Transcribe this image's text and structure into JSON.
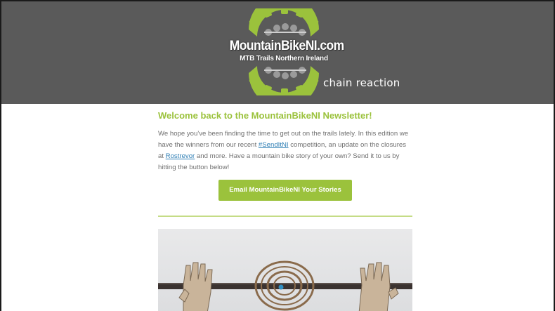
{
  "header": {
    "logo_title": "MountainBikeNI.com",
    "logo_subtitle": "MTB Trails Northern Ireland",
    "tagline": "chain reaction",
    "logo_icon": "chainring-icon",
    "background_color": "#5a5a5a",
    "accent_color": "#9bc23c"
  },
  "newsletter": {
    "headline": "Welcome back to the MountainBikeNI Newsletter!",
    "intro": {
      "part1": "We hope you've been finding the time to get out on the trails lately. In this edition we have the winners from our recent ",
      "link1": "#SendItNI",
      "part2": " competition, an update on the closures at ",
      "link2": "Rostrevor",
      "part3": " and more. Have a mountain bike story of your own? Send it to us by hitting the button below!"
    },
    "cta_label": "Email MountainBikeNI Your Stories",
    "hero_image": "wooden-handlebar-sculpture-photo"
  }
}
